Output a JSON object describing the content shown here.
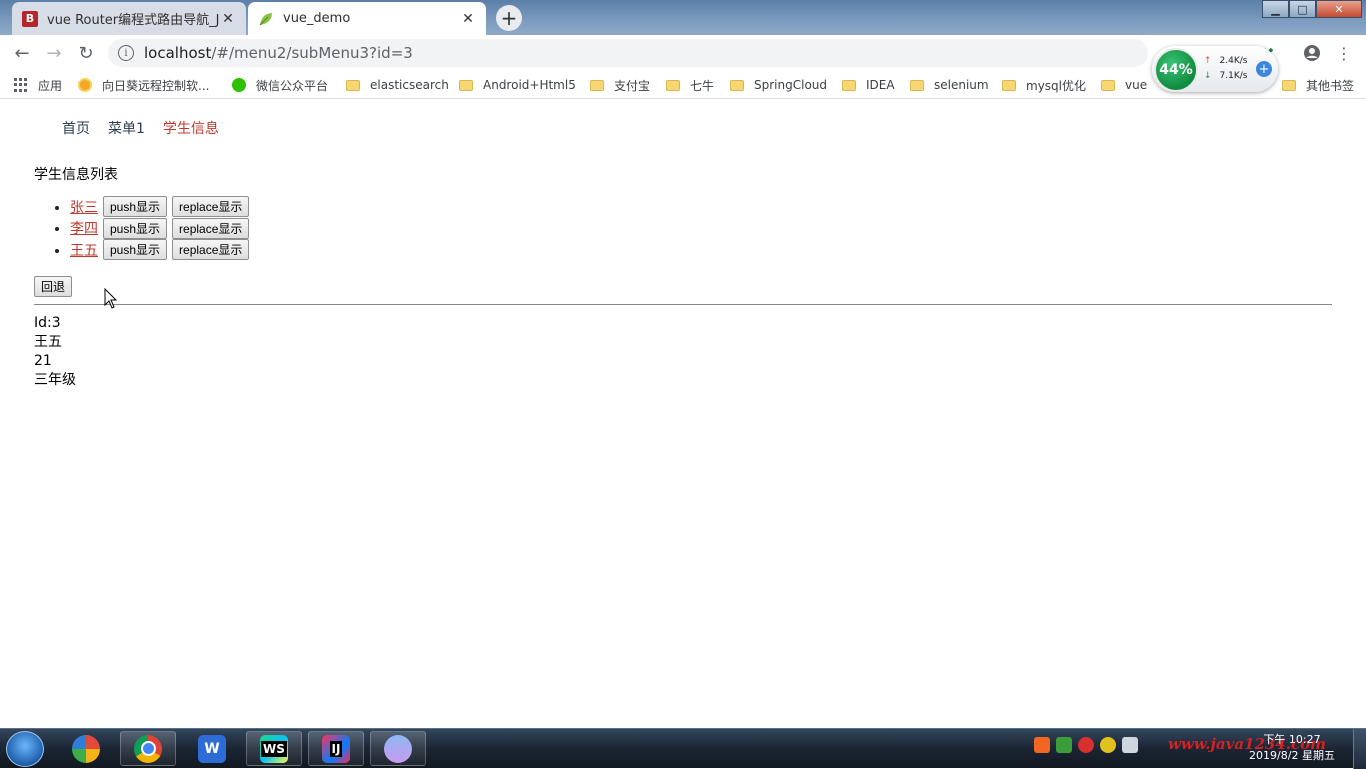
{
  "browser": {
    "tabs": [
      {
        "title": "vue Router编程式路由导航_Java",
        "favicon": "B",
        "active": false
      },
      {
        "title": "vue_demo",
        "favicon": "leaf-icon",
        "active": true
      }
    ],
    "url_host": "localhost",
    "url_rest": "/#/menu2/subMenu3?id=3",
    "bookmarks": [
      {
        "label": "应用",
        "icon": "apps-grid-icon"
      },
      {
        "label": "向日葵远程控制软...",
        "icon": "sunflower-icon"
      },
      {
        "label": "微信公众平台",
        "icon": "wechat-icon"
      },
      {
        "label": "elasticsearch",
        "icon": "folder-icon"
      },
      {
        "label": "Android+Html5",
        "icon": "folder-icon"
      },
      {
        "label": "支付宝",
        "icon": "folder-icon"
      },
      {
        "label": "七牛",
        "icon": "folder-icon"
      },
      {
        "label": "SpringCloud",
        "icon": "folder-icon"
      },
      {
        "label": "IDEA",
        "icon": "folder-icon"
      },
      {
        "label": "selenium",
        "icon": "folder-icon"
      },
      {
        "label": "mysql优化",
        "icon": "folder-icon"
      },
      {
        "label": "vue",
        "icon": "folder-icon"
      },
      {
        "label": "其他书签",
        "icon": "folder-icon"
      }
    ]
  },
  "net_widget": {
    "percent": "44%",
    "up_rate": "2.4K/s",
    "down_rate": "7.1K/s"
  },
  "page": {
    "nav": [
      {
        "label": "首页",
        "active": false
      },
      {
        "label": "菜单1",
        "active": false
      },
      {
        "label": "学生信息",
        "active": true
      }
    ],
    "list_title": "学生信息列表",
    "students": [
      {
        "name": "张三",
        "push_label": "push显示",
        "replace_label": "replace显示"
      },
      {
        "name": "李四",
        "push_label": "push显示",
        "replace_label": "replace显示"
      },
      {
        "name": "王五",
        "push_label": "push显示",
        "replace_label": "replace显示"
      }
    ],
    "back_label": "回退",
    "detail": {
      "id_line": "Id:3",
      "name": "王五",
      "age": "21",
      "grade": "三年级"
    }
  },
  "taskbar": {
    "clock_time": "下午 10:27",
    "clock_date": "2019/8/2 星期五",
    "watermark": "www.java1234.com",
    "apps": [
      "chrome-icon",
      "wps-icon",
      "webstorm-icon",
      "intellij-icon",
      "photos-icon"
    ]
  },
  "colors": {
    "active_link": "#c0392b",
    "nav_text": "#2c3e50",
    "tab_strip": "#7c9cbf"
  }
}
